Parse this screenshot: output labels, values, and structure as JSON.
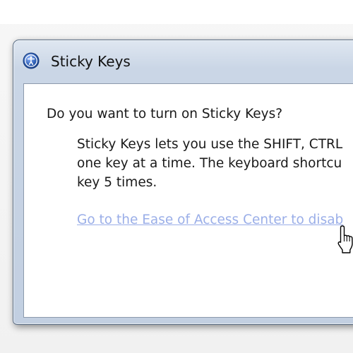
{
  "dialog": {
    "title": "Sticky Keys",
    "icon": "ease-of-access-icon",
    "question": "Do you want to turn on Sticky Keys?",
    "description_lines": [
      "Sticky Keys lets you use the SHIFT, CTRL",
      "one key at a time. The keyboard shortcu",
      "key 5 times."
    ],
    "link_text": "Go to the Ease of Access Center to disab"
  },
  "cursor": {
    "icon": "hand-pointer-icon"
  },
  "colors": {
    "link": "#9aaee8",
    "frame": "#cad6e6",
    "icon_blue": "#2f5fb3"
  }
}
